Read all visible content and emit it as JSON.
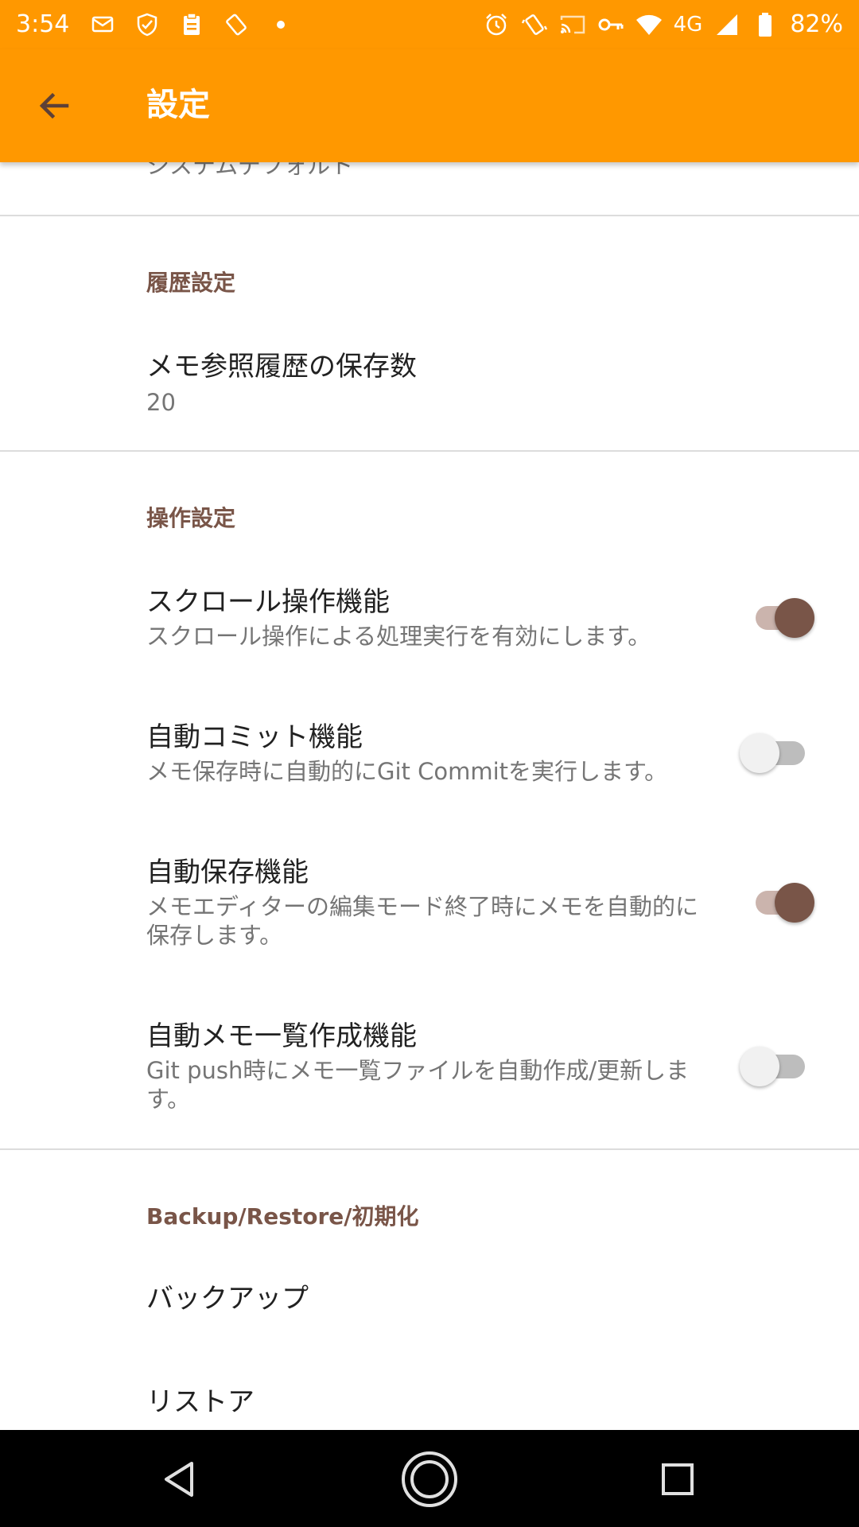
{
  "status_bar": {
    "time": "3:54",
    "left_icons": [
      "sms-icon",
      "shield-check-icon",
      "clipboard-icon",
      "rotate-icon",
      "dot-icon"
    ],
    "right_icons": [
      "alarm-icon",
      "vibrate-icon",
      "cast-icon",
      "vpn-key-icon",
      "wifi-icon"
    ],
    "network": "4G",
    "battery": "82%"
  },
  "app_bar": {
    "title": "設定",
    "back_icon": "arrow-back-icon",
    "color": "#ff9800"
  },
  "accent_color": "#795548",
  "partial_summary": "システムデフォルト",
  "sections": {
    "history": {
      "title": "履歴設定",
      "items": [
        {
          "title": "メモ参照履歴の保存数",
          "summary": "20"
        }
      ]
    },
    "operation": {
      "title": "操作設定",
      "items": [
        {
          "title": "スクロール操作機能",
          "summary": "スクロール操作による処理実行を有効にします。",
          "enabled": true
        },
        {
          "title": "自動コミット機能",
          "summary": "メモ保存時に自動的にGit Commitを実行します。",
          "enabled": false
        },
        {
          "title": "自動保存機能",
          "summary": "メモエディターの編集モード終了時にメモを自動的に保存します。",
          "enabled": true
        },
        {
          "title": "自動メモ一覧作成機能",
          "summary": "Git push時にメモ一覧ファイルを自動作成/更新します。",
          "enabled": false
        }
      ]
    },
    "backup": {
      "title": "Backup/Restore/初期化",
      "items": [
        {
          "title": "バックアップ"
        },
        {
          "title": "リストア"
        }
      ]
    }
  },
  "nav_bar": {
    "back": "nav-back-icon",
    "home": "nav-home-icon",
    "recents": "nav-recents-icon"
  }
}
